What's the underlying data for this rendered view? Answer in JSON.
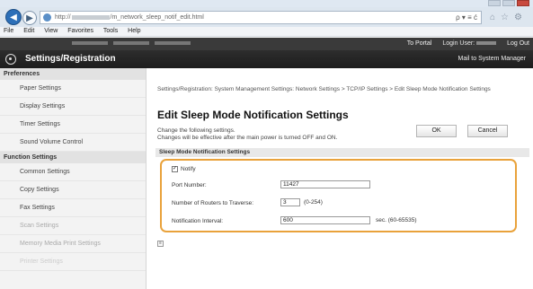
{
  "browser": {
    "address_start": "http://",
    "address_end": "/m_network_sleep_notif_edit.html",
    "address_tools": "ρ ▾ ≡ ć",
    "menu": [
      "File",
      "Edit",
      "View",
      "Favorites",
      "Tools",
      "Help"
    ]
  },
  "device_bar": {
    "portal_label": "To Portal",
    "login_label": "Login User:",
    "logout_label": "Log Out"
  },
  "header": {
    "title": "Settings/Registration",
    "mail_link": "Mail to System Manager"
  },
  "sidebar": {
    "sections": [
      {
        "title": "Preferences",
        "items": [
          "Paper Settings",
          "Display Settings",
          "Timer Settings",
          "Sound Volume Control"
        ]
      },
      {
        "title": "Function Settings",
        "items": [
          "Common Settings",
          "Copy Settings",
          "Fax Settings",
          "Scan Settings",
          "Memory Media Print Settings",
          "Printer Settings"
        ]
      }
    ]
  },
  "main": {
    "breadcrumb": "Settings/Registration: System Management Settings: Network Settings > TCP/IP Settings > Edit Sleep Mode Notification Settings",
    "title": "Edit Sleep Mode Notification Settings",
    "note_line1": "Change the following settings.",
    "note_line2": "Changes will be effective after the main power is turned OFF and ON.",
    "ok_label": "OK",
    "cancel_label": "Cancel",
    "group_title": "Sleep Mode Notification Settings",
    "notify_label": "Notify",
    "port_label": "Port Number:",
    "port_value": "11427",
    "routers_label": "Number of Routers to Traverse:",
    "routers_value": "3",
    "routers_range": "(0-254)",
    "interval_label": "Notification Interval:",
    "interval_value": "600",
    "interval_range": "sec. (60-65535)",
    "expand_glyph": "≡"
  },
  "colors": {
    "highlight_border": "#e9a23b",
    "header_bg": "#1d1d1d"
  }
}
